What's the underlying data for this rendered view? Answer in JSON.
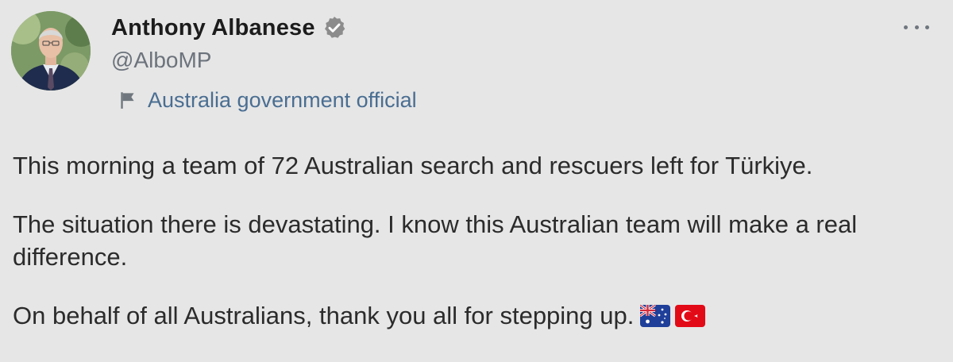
{
  "author": {
    "display_name": "Anthony Albanese",
    "handle": "@AlboMP",
    "verified": true,
    "avatar_icon": "profile-photo",
    "label_icon": "flag-icon",
    "label": "Australia government official"
  },
  "menu": {
    "more_icon": "more-options-icon"
  },
  "tweet": {
    "paragraphs": [
      "This morning a team of 72 Australian search and rescuers left for Türkiye.",
      "The situation there is devastating. I know this Australian team will make a real difference.",
      "On behalf of all Australians, thank you all for stepping up."
    ],
    "emojis": [
      "australia-flag-emoji",
      "turkey-flag-emoji"
    ]
  },
  "colors": {
    "background": "#e6e6e6",
    "label_blue": "#4a6e92",
    "handle_gray": "#6c737c",
    "verified_gray": "#8c8c8c"
  }
}
